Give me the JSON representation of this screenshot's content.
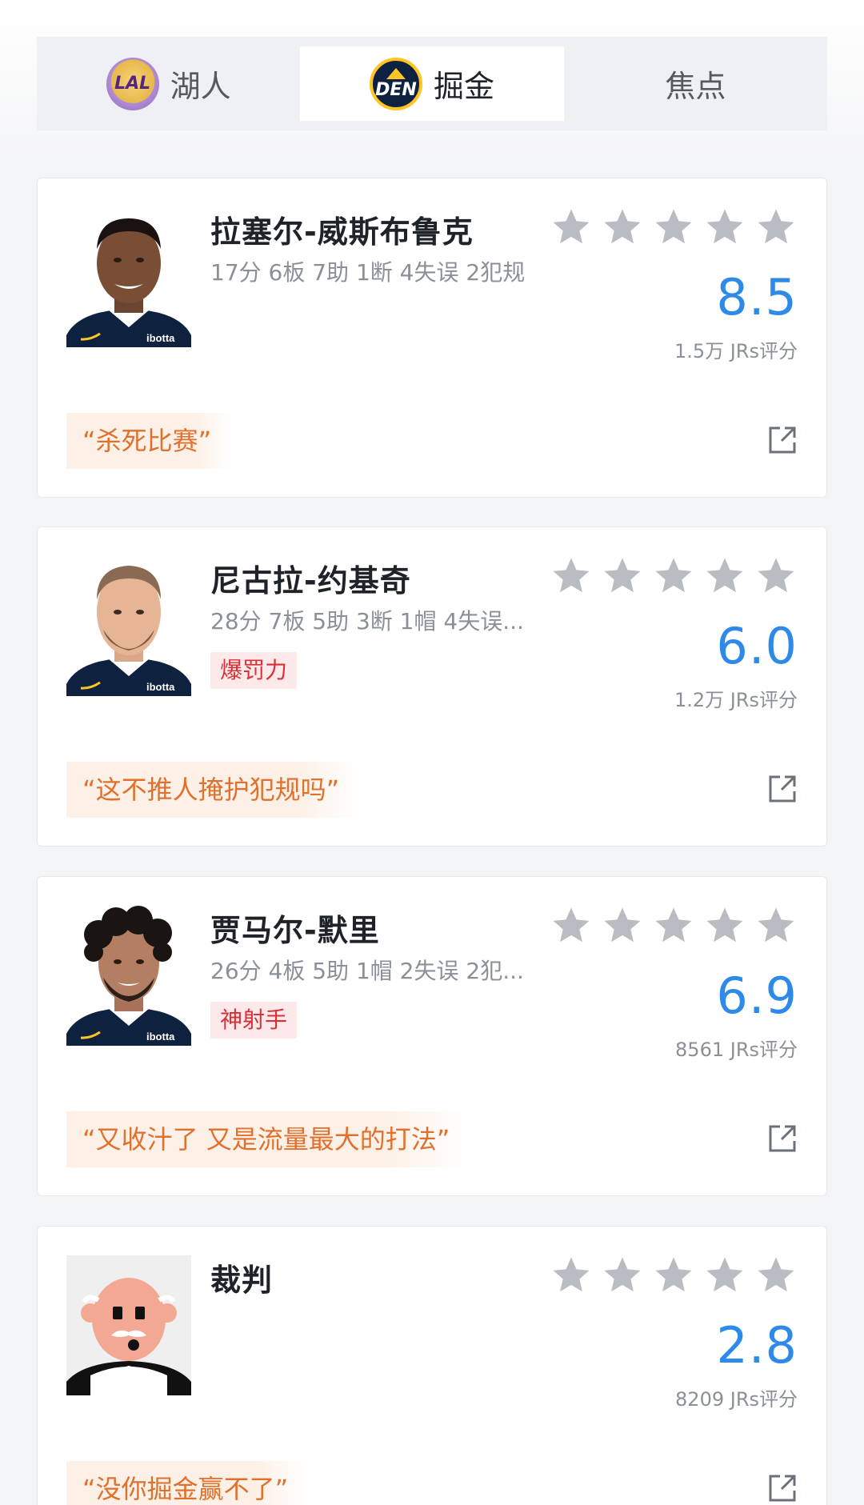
{
  "tabs": [
    {
      "label": "湖人",
      "logo_text": "LAL"
    },
    {
      "label": "掘金",
      "logo_text": "DEN"
    },
    {
      "label": "焦点"
    }
  ],
  "active_tab": 1,
  "colors": {
    "score_blue": "#2d8ae8",
    "quote_orange": "#e0702d",
    "badge_red": "#d93036",
    "star_gray": "#b9bcc2"
  },
  "cards": [
    {
      "name": "拉塞尔-威斯布鲁克",
      "stats": "17分 6板 7助 1断 4失误 2犯规",
      "badge": "",
      "score": "8.5",
      "votes": "1.5万 JRs评分",
      "quote": "“杀死比赛”",
      "rating_stars": 0,
      "jersey_text": "ibotta"
    },
    {
      "name": "尼古拉-约基奇",
      "stats": "28分 7板 5助 3断 1帽 4失误...",
      "badge": "爆罚力",
      "score": "6.0",
      "votes": "1.2万 JRs评分",
      "quote": "“这不推人掩护犯规吗”",
      "rating_stars": 0,
      "jersey_text": "ibotta"
    },
    {
      "name": "贾马尔-默里",
      "stats": "26分 4板 5助 1帽 2失误 2犯...",
      "badge": "神射手",
      "score": "6.9",
      "votes": "8561 JRs评分",
      "quote": "“又收汁了 又是流量最大的打法”",
      "rating_stars": 0,
      "jersey_text": "ibotta"
    },
    {
      "name": "裁判",
      "stats": "",
      "badge": "",
      "score": "2.8",
      "votes": "8209 JRs评分",
      "quote": "“没你掘金赢不了”",
      "rating_stars": 0
    }
  ],
  "icons": {
    "star": "star-icon",
    "share": "share-icon"
  }
}
